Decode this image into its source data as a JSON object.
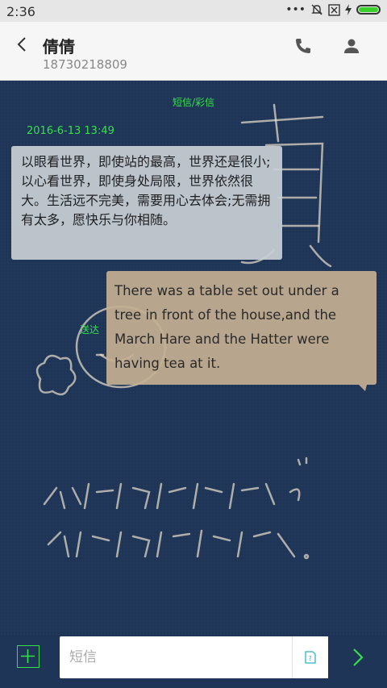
{
  "status_bar": {
    "time": "2:36",
    "icons": [
      "more-dots-icon",
      "mute-icon",
      "no-sim-icon",
      "charging-icon",
      "battery-icon"
    ],
    "battery_color": "#3ad12a"
  },
  "header": {
    "contact_name": "倩倩",
    "contact_number": "18730218809",
    "icons": [
      "back-icon",
      "phone-icon",
      "person-icon"
    ]
  },
  "conversation": {
    "type_label": "短信/彩信",
    "timestamp": "2016-6-13 13:49",
    "messages": [
      {
        "direction": "incoming",
        "text": "以眼看世界，即使站的最高，世界还是很小;以心看世界，即使身处局限，世界依然很大。生活远不完美，需要用心去体会;无需拥有太多，愿快乐与你相随。"
      },
      {
        "direction": "outgoing",
        "text": "There was a table set out under a tree in front of the house,and the March Hare and the Hatter were having tea at it.",
        "status": "送达"
      }
    ]
  },
  "composer": {
    "placeholder": "短信",
    "add_icon": "plus-icon",
    "attach_icon": "sim-card-icon",
    "send_icon": "send-chevron-icon",
    "accent_color": "#34e04a"
  }
}
